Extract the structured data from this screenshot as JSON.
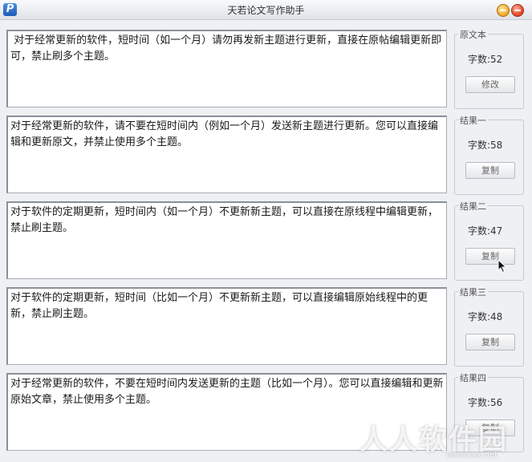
{
  "window": {
    "title": "天若论文写作助手",
    "icon_letter": "P"
  },
  "rows": [
    {
      "text": " 对于经常更新的软件，短时间（如一个月）请勿再发新主题进行更新，直接在原帖编辑更新即可，禁止刷多个主题。",
      "group_label": "原文本",
      "count_label": "字数:52",
      "button_label": "修改"
    },
    {
      "text": "对于经常更新的软件，请不要在短时间内（例如一个月）发送新主题进行更新。您可以直接编辑和更新原文，并禁止使用多个主题。",
      "group_label": "结果一",
      "count_label": "字数:58",
      "button_label": "复制"
    },
    {
      "text": "对于软件的定期更新，短时间内（如一个月）不更新新主题，可以直接在原线程中编辑更新，禁止刷主题。",
      "group_label": "结果二",
      "count_label": "字数:47",
      "button_label": "复制"
    },
    {
      "text": "对于软件的定期更新，短时间（比如一个月）不更新新主题，可以直接编辑原始线程中的更新，禁止刷主题。",
      "group_label": "结果三",
      "count_label": "字数:48",
      "button_label": "复制"
    },
    {
      "text": "对于经常更新的软件，不要在短时间内发送更新的主题（比如一个月）。您可以直接编辑和更新原始文章，禁止使用多个主题。",
      "group_label": "结果四",
      "count_label": "字数:56",
      "button_label": "复制"
    }
  ],
  "watermark": {
    "text": "人人软件园",
    "url": "www.kkx.net"
  }
}
